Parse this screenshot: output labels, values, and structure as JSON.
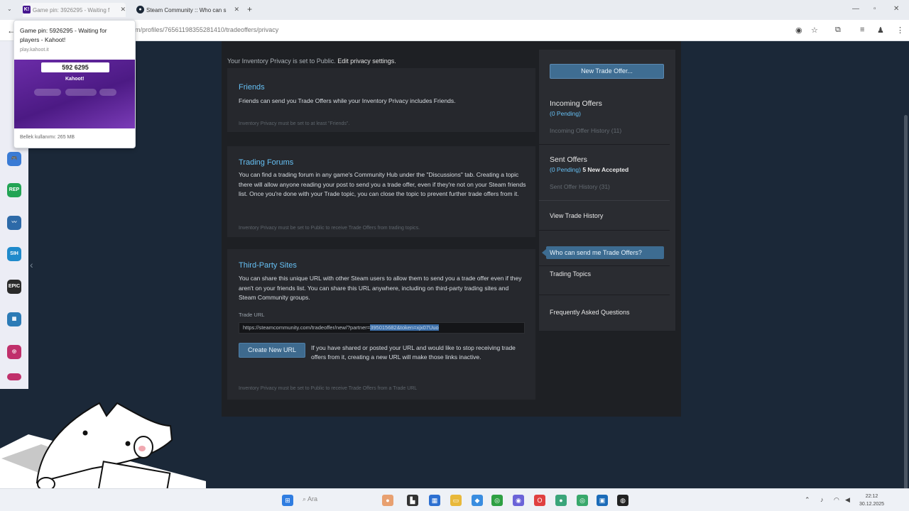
{
  "browser": {
    "tabs": [
      {
        "title": "Game pin: 3926295 - Waiting f",
        "favicon": "K!"
      },
      {
        "title": "Steam Community :: Who can s",
        "favicon": "steam"
      }
    ],
    "url": "m/profiles/76561198355281410/tradeoffers/privacy",
    "tab_card": {
      "title": "Game pin: 5926295 - Waiting for players - Kahoot!",
      "domain": "play.kahoot.it",
      "pin": "592 6295",
      "brand": "Kahoot!",
      "memory": "Bellek kullanımı: 265 MB"
    }
  },
  "page": {
    "privacy_note": "Your Inventory Privacy is set to Public.",
    "privacy_link": "Edit privacy settings.",
    "friends": {
      "title": "Friends",
      "desc": "Friends can send you Trade Offers while your Inventory Privacy includes Friends.",
      "foot": "Inventory Privacy must be set to at least \"Friends\"."
    },
    "forums": {
      "title": "Trading Forums",
      "desc": "You can find a trading forum in any game's Community Hub under the \"Discussions\" tab. Creating a topic there will allow anyone reading your post to send you a trade offer, even if they're not on your Steam friends list. Once you're done with your Trade topic, you can close the topic to prevent further trade offers from it.",
      "foot": "Inventory Privacy must be set to Public to receive Trade Offers from trading topics."
    },
    "third_party": {
      "title": "Third-Party Sites",
      "desc": "You can share this unique URL with other Steam users to allow them to send you a trade offer even if they aren't on your friends list. You can share this URL anywhere, including on third-party trading sites and Steam Community groups.",
      "url_label": "Trade URL",
      "url_prefix": "https://steamcommunity.com/tradeoffer/new/?partner=",
      "url_selected": "395015682&token=xjx07Uuo",
      "create_button": "Create New URL",
      "create_desc": "If you have shared or posted your URL and would like to stop receiving trade offers from it, creating a new URL will make those links inactive.",
      "foot": "Inventory Privacy must be set to Public to receive Trade Offers from a Trade URL"
    }
  },
  "sidebar": {
    "new_offer": "New Trade Offer...",
    "incoming_title": "Incoming Offers",
    "incoming_pending": "(0 Pending)",
    "incoming_history": "Incoming Offer History (11)",
    "sent_title": "Sent Offers",
    "sent_pending": "(0 Pending)",
    "sent_accepted": "5 New Accepted",
    "sent_history": "Sent Offer History (31)",
    "view_history": "View Trade History",
    "who_can": "Who can send me Trade Offers?",
    "topics": "Trading Topics",
    "faq": "Frequently Asked Questions"
  },
  "taskbar": {
    "search": "Ara",
    "time": "22:12",
    "date": "30.12.2025"
  },
  "colors": {
    "steam_bg": "#1b2838",
    "accent": "#66c0f4",
    "button": "#3f6d92"
  }
}
